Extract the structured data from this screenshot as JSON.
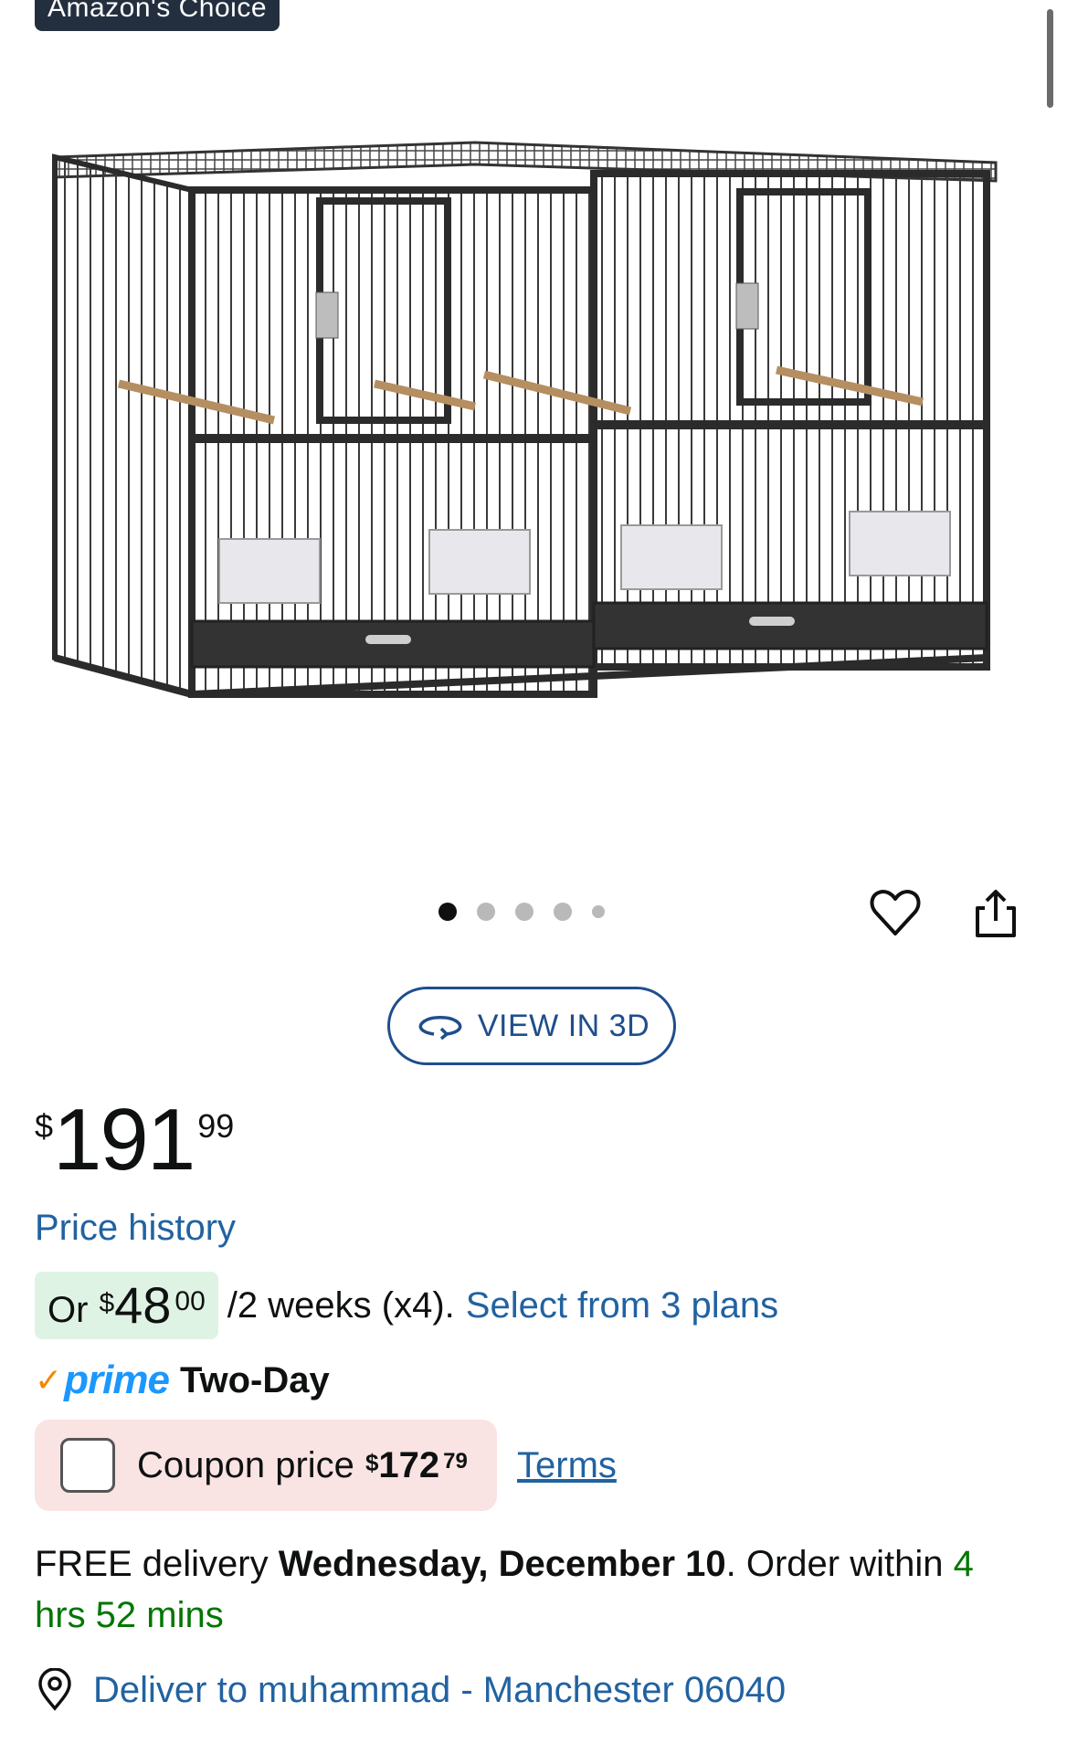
{
  "badge": {
    "label": "Amazon's Choice"
  },
  "gallery": {
    "dot_count": 5,
    "active_index": 0
  },
  "actions": {
    "view_3d_label": "VIEW IN 3D"
  },
  "price": {
    "symbol": "$",
    "whole": "191",
    "fraction": "99"
  },
  "price_history": {
    "label": "Price history"
  },
  "installment": {
    "prefix": "Or",
    "symbol": "$",
    "whole": "48",
    "fraction": "00",
    "suffix": "/2 weeks (x4).",
    "link": "Select from 3 plans"
  },
  "prime": {
    "check": "✓",
    "word": "prime",
    "label": "Two-Day"
  },
  "coupon": {
    "label": "Coupon price",
    "symbol": "$",
    "whole": "172",
    "fraction": "79",
    "terms": "Terms"
  },
  "delivery": {
    "prefix": "FREE delivery",
    "date": "Wednesday, December 10",
    "middle": ". Order within",
    "countdown": "4 hrs 52 mins"
  },
  "deliver_to": {
    "label": "Deliver to muhammad - Manchester 06040"
  },
  "colors": {
    "link": "#2162a1",
    "prime_blue": "#1a98ff",
    "prime_orange": "#f08804",
    "installment_bg": "#dff3e4",
    "coupon_bg": "#fae3e3",
    "countdown_green": "#007600"
  }
}
